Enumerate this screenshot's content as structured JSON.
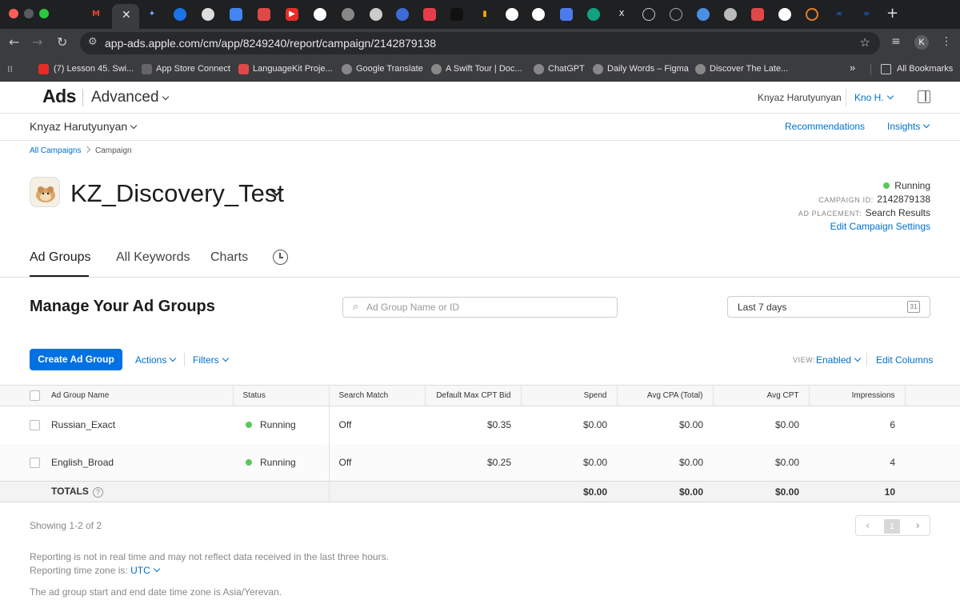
{
  "browser": {
    "url": "app-ads.apple.com/cm/app/8249240/report/campaign/2142879138",
    "active_tab_close": "✕",
    "new_tab": "+",
    "profile_initial": "K",
    "bookmarks": [
      {
        "label": "(7) Lesson 45. Swi...",
        "color": "#e52d27"
      },
      {
        "label": "App Store Connect",
        "color": "#555"
      },
      {
        "label": "LanguageKit Proje...",
        "color": "#e04848"
      },
      {
        "label": "Google Translate",
        "color": "#777"
      },
      {
        "label": "A Swift Tour | Doc...",
        "color": "#777"
      },
      {
        "label": "ChatGPT",
        "color": "#777"
      },
      {
        "label": "Daily Words – Figma",
        "color": "#777"
      },
      {
        "label": "Discover The Late...",
        "color": "#777"
      }
    ],
    "more_bookmarks": "»",
    "all_bookmarks": "All Bookmarks"
  },
  "header": {
    "brand": "Ads",
    "product": "Advanced",
    "user_name": "Knyaz Harutyunyan",
    "account": "Kno H.",
    "org": "Knyaz Harutyunyan",
    "recommendations": "Recommendations",
    "insights": "Insights"
  },
  "breadcrumb": {
    "root": "All Campaigns",
    "current": "Campaign"
  },
  "campaign": {
    "name": "KZ_Discovery_Test",
    "status": "Running",
    "status_color": "#5ac85a",
    "id_label": "CAMPAIGN ID:",
    "id": "2142879138",
    "placement_label": "AD PLACEMENT:",
    "placement": "Search Results",
    "edit_settings": "Edit Campaign Settings"
  },
  "tabs": [
    {
      "label": "Ad Groups",
      "active": true
    },
    {
      "label": "All Keywords",
      "active": false
    },
    {
      "label": "Charts",
      "active": false
    }
  ],
  "section": {
    "title": "Manage Your Ad Groups",
    "search_placeholder": "Ad Group Name or ID",
    "date_range": "Last 7 days",
    "calendar_day": "31",
    "create_button": "Create Ad Group",
    "actions": "Actions",
    "filters": "Filters",
    "view_label": "VIEW:",
    "view_value": "Enabled",
    "edit_columns": "Edit Columns"
  },
  "table": {
    "columns": [
      "Ad Group Name",
      "Status",
      "Search Match",
      "Default Max CPT Bid",
      "Spend",
      "Avg CPA (Total)",
      "Avg CPT",
      "Impressions"
    ],
    "rows": [
      {
        "name": "Russian_Exact",
        "status": "Running",
        "search_match": "Off",
        "bid": "$0.35",
        "spend": "$0.00",
        "avg_cpa": "$0.00",
        "avg_cpt": "$0.00",
        "impressions": "6"
      },
      {
        "name": "English_Broad",
        "status": "Running",
        "search_match": "Off",
        "bid": "$0.25",
        "spend": "$0.00",
        "avg_cpa": "$0.00",
        "avg_cpt": "$0.00",
        "impressions": "4"
      }
    ],
    "totals": {
      "label": "TOTALS",
      "spend": "$0.00",
      "avg_cpa": "$0.00",
      "avg_cpt": "$0.00",
      "impressions": "10"
    }
  },
  "footer": {
    "showing": "Showing 1-2 of 2",
    "page": "1",
    "note_realtime": "Reporting is not in real time and may not reflect data received in the last three hours.",
    "timezone_label": "Reporting time zone is:",
    "timezone": "UTC",
    "adgroup_tz_note": "The ad group start and end date time zone is Asia/Yerevan."
  }
}
